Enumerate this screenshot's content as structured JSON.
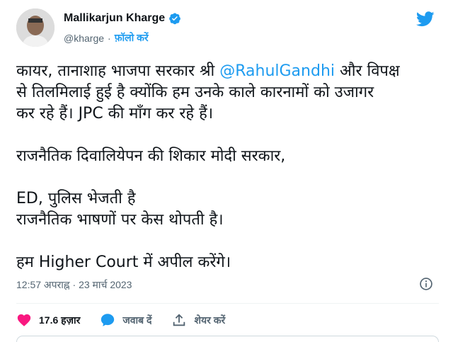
{
  "author": {
    "name": "Mallikarjun Kharge",
    "handle": "@kharge",
    "separator": "·",
    "follow_label": "फ़ॉलो करें"
  },
  "tweet": {
    "line1_pre": "कायर, तानाशाह भाजपा सरकार श्री ",
    "mention": "@RahulGandhi",
    "line1_post": " और विपक्ष",
    "line2": "से तिलमिलाई हुई है क्योंकि हम उनके काले कारनामों को उजागर",
    "line3": "कर रहे हैं। JPC की माँग कर रहे हैं।",
    "line4": "राजनैतिक दिवालियेपन की शिकार मोदी सरकार,",
    "line5": "ED, पुलिस भेजती है",
    "line6": "राजनैतिक भाषणों पर केस थोपती है।",
    "line7": "हम Higher Court में अपील करेंगे।"
  },
  "meta": {
    "timestamp": "12:57 अपराह्न · 23 मार्च 2023"
  },
  "actions": {
    "likes": "17.6 हज़ार",
    "reply": "जवाब दें",
    "share": "शेयर करें"
  },
  "colors": {
    "accent": "#1d9bf0",
    "like": "#f91880",
    "muted": "#536471"
  },
  "icons": [
    "verified-icon",
    "twitter-bird-icon",
    "info-icon",
    "heart-icon",
    "reply-bubble-icon",
    "share-icon"
  ]
}
